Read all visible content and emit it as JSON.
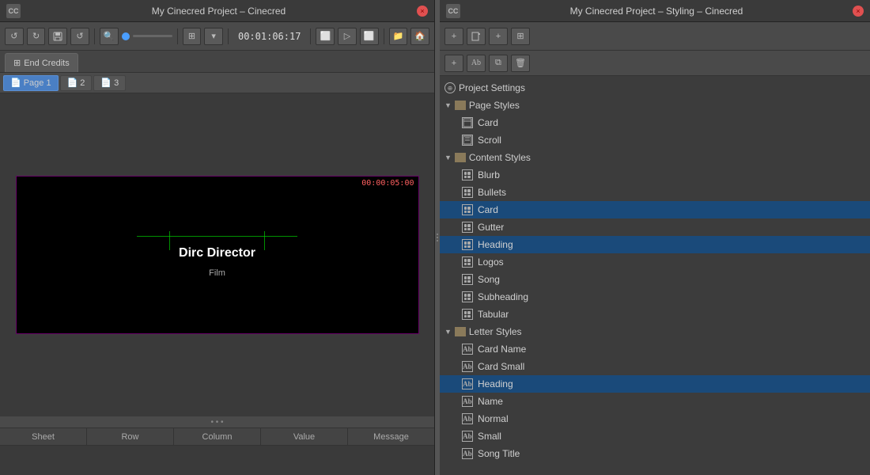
{
  "leftWindow": {
    "title": "My Cinecred Project – Cinecred",
    "closeBtn": "×",
    "toolbar": {
      "undoLabel": "↺",
      "redoLabel": "↻",
      "saveLabel": "💾",
      "undoBtn2": "↺",
      "zoomSearch": "🔍",
      "gridBtn": "⊞",
      "timecode": "00:01:06:17",
      "frameBtn1": "⬜",
      "frameBtn2": "▷",
      "frameBtn3": "⬜",
      "folderBtn": "📁",
      "homeBtn": "🏠"
    },
    "tabs": [
      {
        "label": "End Credits",
        "icon": "⊞",
        "active": true
      }
    ],
    "pageTabs": [
      {
        "label": "Page 1",
        "icon": "📄",
        "active": true
      },
      {
        "label": "2",
        "icon": "📄",
        "active": false
      },
      {
        "label": "3",
        "icon": "📄",
        "active": false
      }
    ],
    "canvas": {
      "timecodeOverlay": "00:00:05:00",
      "mainText": "Dirc Director",
      "subText": "Film"
    },
    "table": {
      "columns": [
        "Sheet",
        "Row",
        "Column",
        "Value",
        "Message"
      ]
    }
  },
  "rightWindow": {
    "title": "My Cinecred Project – Styling – Cinecred",
    "closeBtn": "×",
    "projectSettings": "Project Settings",
    "sections": [
      {
        "label": "Page Styles",
        "type": "folder",
        "items": [
          {
            "label": "Card",
            "iconType": "page"
          },
          {
            "label": "Scroll",
            "iconType": "page"
          }
        ]
      },
      {
        "label": "Content Styles",
        "type": "folder",
        "items": [
          {
            "label": "Blurb",
            "iconType": "content"
          },
          {
            "label": "Bullets",
            "iconType": "content"
          },
          {
            "label": "Card",
            "iconType": "content",
            "selected": true
          },
          {
            "label": "Gutter",
            "iconType": "content"
          },
          {
            "label": "Heading",
            "iconType": "content",
            "selected": true
          },
          {
            "label": "Logos",
            "iconType": "content"
          },
          {
            "label": "Song",
            "iconType": "content"
          },
          {
            "label": "Subheading",
            "iconType": "content"
          },
          {
            "label": "Tabular",
            "iconType": "content"
          }
        ]
      },
      {
        "label": "Letter Styles",
        "type": "folder",
        "items": [
          {
            "label": "Card Name",
            "iconType": "letter"
          },
          {
            "label": "Card Small",
            "iconType": "letter"
          },
          {
            "label": "Heading",
            "iconType": "letter",
            "selected": true
          },
          {
            "label": "Name",
            "iconType": "letter"
          },
          {
            "label": "Normal",
            "iconType": "letter"
          },
          {
            "label": "Small",
            "iconType": "letter"
          },
          {
            "label": "Song Title",
            "iconType": "letter"
          }
        ]
      }
    ]
  }
}
